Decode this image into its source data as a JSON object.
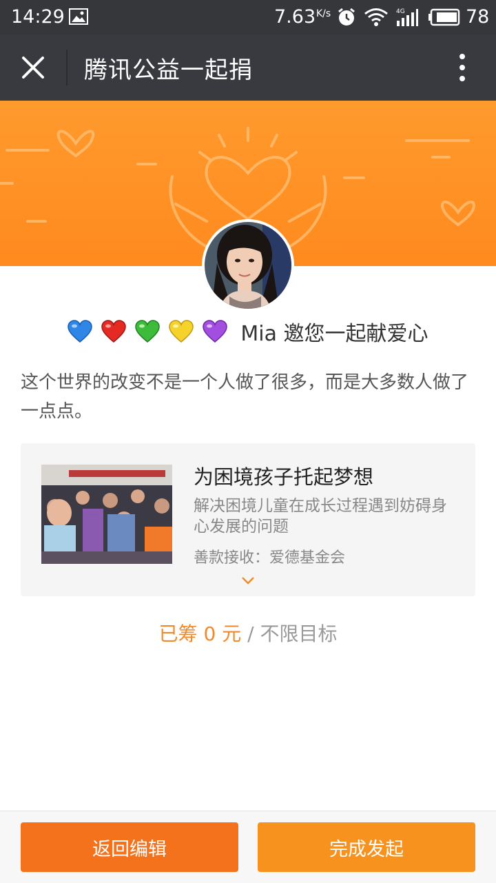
{
  "status_bar": {
    "time": "14:29",
    "net_speed": "7.63",
    "net_speed_unit": "K/s",
    "signal_label": "4G",
    "battery": "78"
  },
  "title_bar": {
    "title": "腾讯公益一起捐"
  },
  "invite": {
    "hearts": [
      "blue-heart",
      "red-heart",
      "green-heart",
      "yellow-heart",
      "purple-heart"
    ],
    "text": "Mia 邀您一起献爱心"
  },
  "quote": "这个世界的改变不是一个人做了很多，而是大多数人做了一点点。",
  "project": {
    "title": "为困境孩子托起梦想",
    "description": "解决困境儿童在成长过程遇到妨碍身心发展的问题",
    "recipient": "善款接收：爱德基金会"
  },
  "raised": {
    "prefix": "已筹",
    "amount": "0",
    "unit": "元",
    "separator": "/",
    "target": "不限目标"
  },
  "buttons": {
    "back": "返回编辑",
    "done": "完成发起"
  },
  "colors": {
    "accent_orange": "#f7921e",
    "back_button": "#f4721c",
    "highlight": "#f08a2c",
    "title_bar": "#393a3f"
  }
}
